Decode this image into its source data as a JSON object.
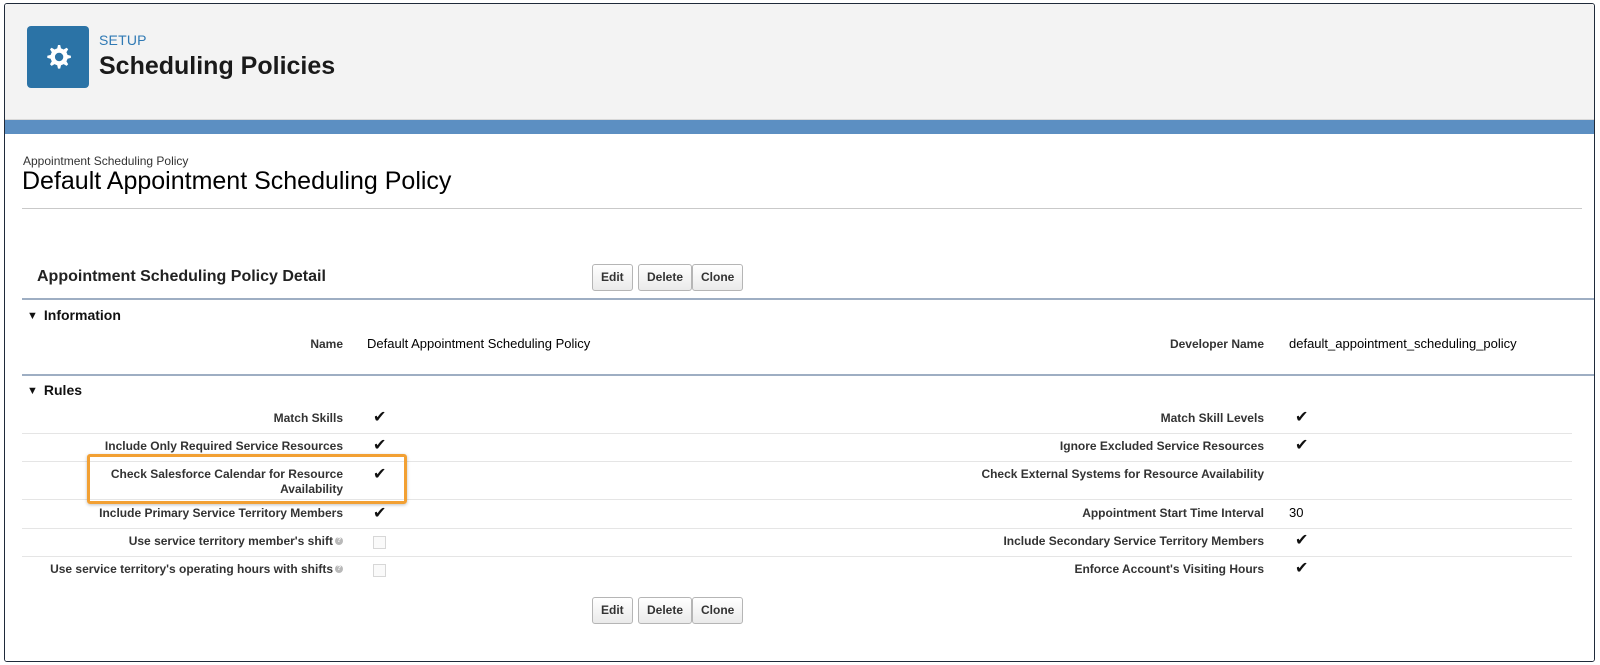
{
  "header": {
    "label": "SETUP",
    "title": "Scheduling Policies",
    "icon": "gear-icon"
  },
  "record": {
    "type_label": "Appointment Scheduling Policy",
    "title": "Default Appointment Scheduling Policy"
  },
  "detail": {
    "section_title": "Appointment Scheduling Policy Detail",
    "buttons": {
      "edit": "Edit",
      "delete": "Delete",
      "clone": "Clone"
    }
  },
  "information": {
    "header": "Information",
    "name_label": "Name",
    "name_value": "Default Appointment Scheduling Policy",
    "dev_name_label": "Developer Name",
    "dev_name_value": "default_appointment_scheduling_policy"
  },
  "rules": {
    "header": "Rules",
    "left": [
      {
        "label": "Match Skills",
        "checked": true
      },
      {
        "label": "Include Only Required Service Resources",
        "checked": true
      },
      {
        "label": "Check Salesforce Calendar for Resource Availability",
        "checked": true,
        "highlighted": true
      },
      {
        "label": "Include Primary Service Territory Members",
        "checked": true
      },
      {
        "label": "Use service territory member's shift",
        "checked": false,
        "help": true
      },
      {
        "label": "Use service territory's operating hours with shifts",
        "checked": false,
        "help": true
      }
    ],
    "right": [
      {
        "label": "Match Skill Levels",
        "checked": true
      },
      {
        "label": "Ignore Excluded Service Resources",
        "checked": true
      },
      {
        "label": "Check External Systems for Resource Availability",
        "checked": false
      },
      {
        "label": "Appointment Start Time Interval",
        "value": "30"
      },
      {
        "label": "Include Secondary Service Territory Members",
        "checked": true
      },
      {
        "label": "Enforce Account's Visiting Hours",
        "checked": true
      }
    ]
  },
  "colors": {
    "accent_blue": "#2b73a6",
    "band_blue": "#5c8fc2",
    "highlight_orange": "#f2a033"
  }
}
